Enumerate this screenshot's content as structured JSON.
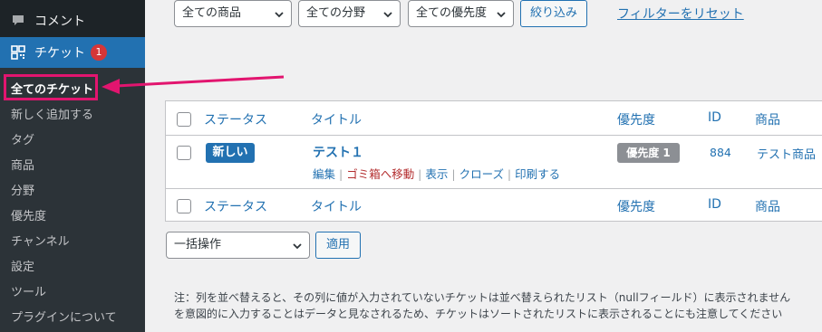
{
  "sidebar": {
    "comments_label": "コメント",
    "tickets_label": "チケット",
    "tickets_badge": "1",
    "submenu": [
      {
        "label": "全てのチケット",
        "current": true
      },
      {
        "label": "新しく追加する"
      },
      {
        "label": "タグ"
      },
      {
        "label": "商品"
      },
      {
        "label": "分野"
      },
      {
        "label": "優先度"
      },
      {
        "label": "チャンネル"
      },
      {
        "label": "設定"
      },
      {
        "label": "ツール"
      },
      {
        "label": "プラグインについて"
      }
    ]
  },
  "filters": {
    "product_select": "全ての商品",
    "category_select": "全ての分野",
    "priority_select": "全ての優先度",
    "filter_button": "絞り込み",
    "reset_link": "フィルターをリセット"
  },
  "table": {
    "columns": {
      "status": "ステータス",
      "title": "タイトル",
      "priority": "優先度",
      "id": "ID",
      "product": "商品"
    },
    "row": {
      "status": "新しい",
      "title": "テスト１",
      "priority": "優先度 1",
      "id": "884",
      "product": "テスト商品",
      "actions": {
        "edit": "編集",
        "trash": "ゴミ箱へ移動",
        "view": "表示",
        "close": "クローズ",
        "print": "印刷する"
      }
    }
  },
  "bulk": {
    "select": "一括操作",
    "apply_button": "適用"
  },
  "note": {
    "line1": "注：列を並べ替えると、その列に値が入力されていないチケットは並べ替えられたリスト（nullフィールド）に表示されません",
    "line2": "を意図的に入力することはデータと見なされるため、チケットはソートされたリストに表示されることにも注意してください"
  },
  "colors": {
    "accent": "#2271b1",
    "highlight": "#e2156f",
    "badge": "#d63638"
  }
}
